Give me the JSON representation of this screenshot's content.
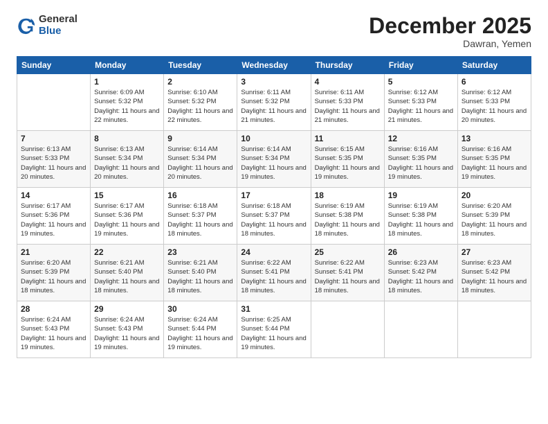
{
  "logo": {
    "general": "General",
    "blue": "Blue"
  },
  "header": {
    "month": "December 2025",
    "location": "Dawran, Yemen"
  },
  "weekdays": [
    "Sunday",
    "Monday",
    "Tuesday",
    "Wednesday",
    "Thursday",
    "Friday",
    "Saturday"
  ],
  "weeks": [
    [
      {
        "day": "",
        "info": ""
      },
      {
        "day": "1",
        "info": "Sunrise: 6:09 AM\nSunset: 5:32 PM\nDaylight: 11 hours\nand 22 minutes."
      },
      {
        "day": "2",
        "info": "Sunrise: 6:10 AM\nSunset: 5:32 PM\nDaylight: 11 hours\nand 22 minutes."
      },
      {
        "day": "3",
        "info": "Sunrise: 6:11 AM\nSunset: 5:32 PM\nDaylight: 11 hours\nand 21 minutes."
      },
      {
        "day": "4",
        "info": "Sunrise: 6:11 AM\nSunset: 5:33 PM\nDaylight: 11 hours\nand 21 minutes."
      },
      {
        "day": "5",
        "info": "Sunrise: 6:12 AM\nSunset: 5:33 PM\nDaylight: 11 hours\nand 21 minutes."
      },
      {
        "day": "6",
        "info": "Sunrise: 6:12 AM\nSunset: 5:33 PM\nDaylight: 11 hours\nand 20 minutes."
      }
    ],
    [
      {
        "day": "7",
        "info": "Sunrise: 6:13 AM\nSunset: 5:33 PM\nDaylight: 11 hours\nand 20 minutes."
      },
      {
        "day": "8",
        "info": "Sunrise: 6:13 AM\nSunset: 5:34 PM\nDaylight: 11 hours\nand 20 minutes."
      },
      {
        "day": "9",
        "info": "Sunrise: 6:14 AM\nSunset: 5:34 PM\nDaylight: 11 hours\nand 20 minutes."
      },
      {
        "day": "10",
        "info": "Sunrise: 6:14 AM\nSunset: 5:34 PM\nDaylight: 11 hours\nand 19 minutes."
      },
      {
        "day": "11",
        "info": "Sunrise: 6:15 AM\nSunset: 5:35 PM\nDaylight: 11 hours\nand 19 minutes."
      },
      {
        "day": "12",
        "info": "Sunrise: 6:16 AM\nSunset: 5:35 PM\nDaylight: 11 hours\nand 19 minutes."
      },
      {
        "day": "13",
        "info": "Sunrise: 6:16 AM\nSunset: 5:35 PM\nDaylight: 11 hours\nand 19 minutes."
      }
    ],
    [
      {
        "day": "14",
        "info": "Sunrise: 6:17 AM\nSunset: 5:36 PM\nDaylight: 11 hours\nand 19 minutes."
      },
      {
        "day": "15",
        "info": "Sunrise: 6:17 AM\nSunset: 5:36 PM\nDaylight: 11 hours\nand 19 minutes."
      },
      {
        "day": "16",
        "info": "Sunrise: 6:18 AM\nSunset: 5:37 PM\nDaylight: 11 hours\nand 18 minutes."
      },
      {
        "day": "17",
        "info": "Sunrise: 6:18 AM\nSunset: 5:37 PM\nDaylight: 11 hours\nand 18 minutes."
      },
      {
        "day": "18",
        "info": "Sunrise: 6:19 AM\nSunset: 5:38 PM\nDaylight: 11 hours\nand 18 minutes."
      },
      {
        "day": "19",
        "info": "Sunrise: 6:19 AM\nSunset: 5:38 PM\nDaylight: 11 hours\nand 18 minutes."
      },
      {
        "day": "20",
        "info": "Sunrise: 6:20 AM\nSunset: 5:39 PM\nDaylight: 11 hours\nand 18 minutes."
      }
    ],
    [
      {
        "day": "21",
        "info": "Sunrise: 6:20 AM\nSunset: 5:39 PM\nDaylight: 11 hours\nand 18 minutes."
      },
      {
        "day": "22",
        "info": "Sunrise: 6:21 AM\nSunset: 5:40 PM\nDaylight: 11 hours\nand 18 minutes."
      },
      {
        "day": "23",
        "info": "Sunrise: 6:21 AM\nSunset: 5:40 PM\nDaylight: 11 hours\nand 18 minutes."
      },
      {
        "day": "24",
        "info": "Sunrise: 6:22 AM\nSunset: 5:41 PM\nDaylight: 11 hours\nand 18 minutes."
      },
      {
        "day": "25",
        "info": "Sunrise: 6:22 AM\nSunset: 5:41 PM\nDaylight: 11 hours\nand 18 minutes."
      },
      {
        "day": "26",
        "info": "Sunrise: 6:23 AM\nSunset: 5:42 PM\nDaylight: 11 hours\nand 18 minutes."
      },
      {
        "day": "27",
        "info": "Sunrise: 6:23 AM\nSunset: 5:42 PM\nDaylight: 11 hours\nand 18 minutes."
      }
    ],
    [
      {
        "day": "28",
        "info": "Sunrise: 6:24 AM\nSunset: 5:43 PM\nDaylight: 11 hours\nand 19 minutes."
      },
      {
        "day": "29",
        "info": "Sunrise: 6:24 AM\nSunset: 5:43 PM\nDaylight: 11 hours\nand 19 minutes."
      },
      {
        "day": "30",
        "info": "Sunrise: 6:24 AM\nSunset: 5:44 PM\nDaylight: 11 hours\nand 19 minutes."
      },
      {
        "day": "31",
        "info": "Sunrise: 6:25 AM\nSunset: 5:44 PM\nDaylight: 11 hours\nand 19 minutes."
      },
      {
        "day": "",
        "info": ""
      },
      {
        "day": "",
        "info": ""
      },
      {
        "day": "",
        "info": ""
      }
    ]
  ]
}
